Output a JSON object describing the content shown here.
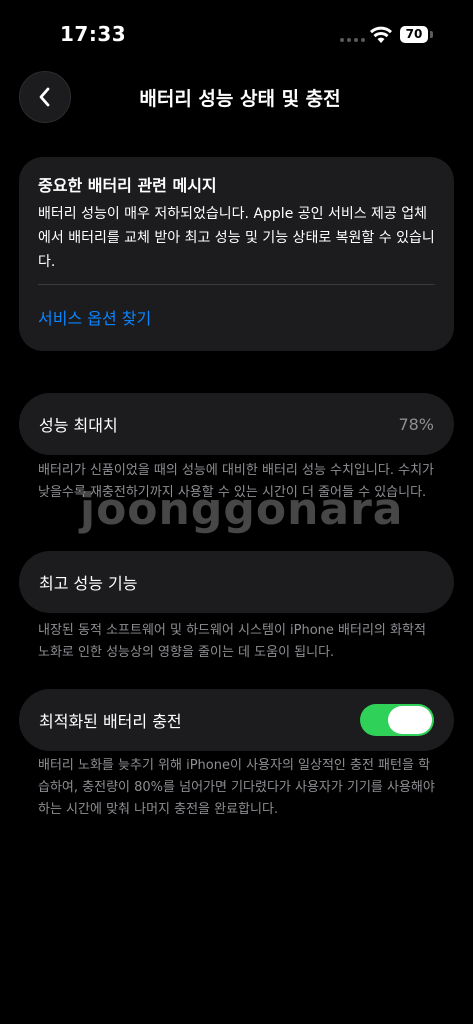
{
  "status_bar": {
    "time": "17:33",
    "battery_level": "70"
  },
  "nav": {
    "title": "배터리 성능 상태 및 충전"
  },
  "message_card": {
    "title": "중요한 배터리 관련 메시지",
    "body": "배터리 성능이 매우 저하되었습니다. Apple 공인 서비스 제공 업체에서 배터리를 교체 받아 최고 성능 및 기능 상태로 복원할 수 있습니다.",
    "link": "서비스 옵션 찾기"
  },
  "max_capacity": {
    "label": "성능 최대치",
    "value": "78%",
    "footnote": "배터리가 신품이었을 때의 성능에 대비한 배터리 성능 수치입니다. 수치가 낮을수록 재충전하기까지 사용할 수 있는 시간이 더 줄어들 수 있습니다."
  },
  "peak_performance": {
    "label": "최고 성능 기능",
    "footnote": "내장된 동적 소프트웨어 및 하드웨어 시스템이 iPhone 배터리의 화학적 노화로 인한 성능상의 영향을 줄이는 데 도움이 됩니다."
  },
  "optimized_charging": {
    "label": "최적화된 배터리 충전",
    "enabled": true,
    "footnote": "배터리 노화를 늦추기 위해 iPhone이 사용자의 일상적인 충전 패턴을 학습하여, 충전량이 80%를 넘어가면 기다렸다가 사용자가 기기를 사용해야 하는 시간에 맞춰 나머지 충전을 완료합니다."
  },
  "watermark": "joonggonara",
  "colors": {
    "background": "#000000",
    "card": "#1c1c1e",
    "link": "#0a84ff",
    "toggle_on": "#30d158",
    "secondary_text": "#8e8e93"
  },
  "icons": {
    "back": "chevron-left-icon",
    "wifi": "wifi-icon",
    "battery": "battery-icon"
  }
}
